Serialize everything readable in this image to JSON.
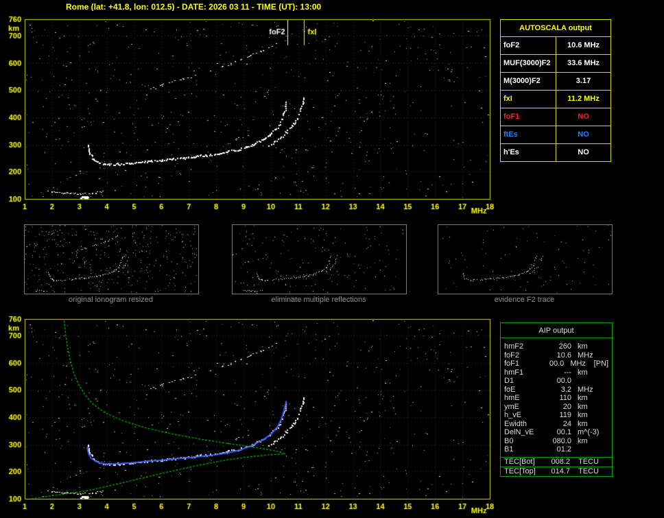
{
  "title": "Rome (lat: +41.8, lon: 012.5) - DATE: 2026 03 11 - TIME (UT): 13:00",
  "colors": {
    "background": "#000000",
    "axis_yellow": "#d6d600",
    "label_yellow": "#ffff00",
    "table_border_yellow": "#d6d600",
    "aip_border_green": "#00a000",
    "profile_green": "#00c000",
    "restored_blue": "#3a5bff",
    "red": "#ff2020",
    "blue": "#2080ff",
    "white": "#ffffff",
    "caption_gray": "#8f8f8f"
  },
  "autoscala_table": {
    "title": "AUTOSCALA output",
    "rows": [
      {
        "label": "foF2",
        "value": "10.6 MHz",
        "label_color": "#ffffff",
        "value_color": "#ffffff"
      },
      {
        "label": "MUF(3000)F2",
        "value": "33.6 MHz",
        "label_color": "#ffffff",
        "value_color": "#ffffff"
      },
      {
        "label": "M(3000)F2",
        "value": "3.17",
        "label_color": "#ffffff",
        "value_color": "#ffffff"
      },
      {
        "label": "fxI",
        "value": "11.2 MHz",
        "label_color": "#ffff00",
        "value_color": "#ffff00"
      },
      {
        "label": "foF1",
        "value": "NO",
        "label_color": "#ff2020",
        "value_color": "#ff2020"
      },
      {
        "label": "ftEs",
        "value": "NO",
        "label_color": "#2080ff",
        "value_color": "#2080ff"
      },
      {
        "label": "h'Es",
        "value": "NO",
        "label_color": "#ffffff",
        "value_color": "#ffffff"
      }
    ]
  },
  "thumbnails": [
    {
      "caption": "original ionogram resized",
      "traces": [
        "E",
        "blob",
        "F_o",
        "F_x",
        "hop2"
      ],
      "noise": 380
    },
    {
      "caption": "eliminate multiple reflections",
      "traces": [
        "E",
        "blob",
        "F_o",
        "F_x"
      ],
      "noise": 170
    },
    {
      "caption": "evidence F2 trace",
      "traces": [
        "F_o",
        "F_x"
      ],
      "noise": 90
    }
  ],
  "aip_table": {
    "title": "AIP output",
    "rows": [
      {
        "label": "hmF2",
        "value": "260",
        "unit": "km",
        "extra": ""
      },
      {
        "label": "foF2",
        "value": "10.6",
        "unit": "MHz",
        "extra": ""
      },
      {
        "label": "foF1",
        "value": "00.0",
        "unit": "MHz",
        "extra": "[PN]"
      },
      {
        "label": "hmF1",
        "value": "---",
        "unit": "km",
        "extra": ""
      },
      {
        "label": "D1",
        "value": "00.0",
        "unit": "",
        "extra": ""
      },
      {
        "label": "foE",
        "value": "3.2",
        "unit": "MHz",
        "extra": ""
      },
      {
        "label": "hmE",
        "value": "110",
        "unit": "km",
        "extra": ""
      },
      {
        "label": "ymE",
        "value": "20",
        "unit": "km",
        "extra": ""
      },
      {
        "label": "h_vE",
        "value": "119",
        "unit": "km",
        "extra": ""
      },
      {
        "label": "Ewidth",
        "value": "24",
        "unit": "km",
        "extra": ""
      },
      {
        "label": "DelN_vE",
        "value": "00.1",
        "unit": "m^(-3)",
        "extra": ""
      },
      {
        "label": "B0",
        "value": "080.0",
        "unit": "km",
        "extra": ""
      },
      {
        "label": "B1",
        "value": "01.2",
        "unit": "",
        "extra": ""
      }
    ],
    "tec_rows": [
      {
        "label": "TEC[Bot]",
        "value": "008.2",
        "unit": "TECU"
      },
      {
        "label": "TEC[Top]",
        "value": "014.7",
        "unit": "TECU"
      }
    ]
  },
  "chart_data": [
    {
      "type": "scatter",
      "name": "ionogram-top",
      "title": "ionogram with autoscaled characteristics",
      "xlabel": "MHz",
      "ylabel": "km",
      "xlim": [
        1,
        18
      ],
      "ylim": [
        100,
        760
      ],
      "x_ticks": [
        1,
        2,
        3,
        4,
        5,
        6,
        7,
        8,
        9,
        10,
        11,
        12,
        13,
        14,
        15,
        16,
        17,
        18
      ],
      "y_ticks": [
        100,
        200,
        300,
        400,
        500,
        600,
        700,
        760
      ],
      "grid": "dotted",
      "noise_count": 620,
      "markers": [
        {
          "label": "foF2",
          "freq": 10.6,
          "color": "#ffffff",
          "side": "left"
        },
        {
          "label": "fxI",
          "freq": 11.2,
          "color": "#ffff00",
          "side": "right"
        }
      ],
      "traces": [
        {
          "name": "E",
          "points": [
            [
              1.85,
              130
            ],
            [
              2.1,
              126
            ],
            [
              2.4,
              123
            ],
            [
              2.7,
              121
            ],
            [
              3.0,
              120
            ],
            [
              3.3,
              121
            ],
            [
              3.6,
              124
            ],
            [
              3.85,
              128
            ]
          ]
        },
        {
          "name": "blob",
          "points": [
            [
              3.05,
              108
            ],
            [
              3.3,
              108
            ]
          ]
        },
        {
          "name": "F_o",
          "points": [
            [
              3.3,
              298
            ],
            [
              3.38,
              268
            ],
            [
              3.5,
              248
            ],
            [
              3.65,
              238
            ],
            [
              3.85,
              231
            ],
            [
              4.1,
              228
            ],
            [
              4.4,
              229
            ],
            [
              4.8,
              232
            ],
            [
              5.2,
              236
            ],
            [
              5.6,
              240
            ],
            [
              6.0,
              244
            ],
            [
              6.4,
              248
            ],
            [
              6.8,
              252
            ],
            [
              7.2,
              256
            ],
            [
              7.6,
              261
            ],
            [
              8.0,
              267
            ],
            [
              8.4,
              274
            ],
            [
              8.8,
              283
            ],
            [
              9.1,
              293
            ],
            [
              9.4,
              305
            ],
            [
              9.7,
              320
            ],
            [
              9.95,
              337
            ],
            [
              10.15,
              355
            ],
            [
              10.3,
              375
            ],
            [
              10.4,
              398
            ],
            [
              10.48,
              424
            ],
            [
              10.54,
              450
            ],
            [
              10.57,
              466
            ]
          ]
        },
        {
          "name": "F_x",
          "points": [
            [
              9.9,
              296
            ],
            [
              10.2,
              315
            ],
            [
              10.5,
              340
            ],
            [
              10.75,
              368
            ],
            [
              10.95,
              398
            ],
            [
              11.08,
              428
            ],
            [
              11.15,
              452
            ],
            [
              11.19,
              472
            ]
          ]
        },
        {
          "name": "hop2",
          "points": [
            [
              5.6,
              505
            ],
            [
              6.0,
              518
            ],
            [
              6.4,
              530
            ],
            [
              6.8,
              542
            ],
            [
              7.2,
              554
            ],
            [
              7.6,
              567
            ],
            [
              8.0,
              580
            ],
            [
              8.4,
              594
            ],
            [
              8.8,
              610
            ],
            [
              9.2,
              626
            ],
            [
              9.6,
              644
            ],
            [
              9.9,
              658
            ],
            [
              10.15,
              670
            ]
          ]
        }
      ]
    },
    {
      "type": "scatter",
      "name": "ionogram-bottom",
      "title": "ionogram with restored trace and electron density profile",
      "xlabel": "MHz",
      "ylabel": "km",
      "xlim": [
        1,
        18
      ],
      "ylim": [
        100,
        760
      ],
      "x_ticks": [
        1,
        2,
        3,
        4,
        5,
        6,
        7,
        8,
        9,
        10,
        11,
        12,
        13,
        14,
        15,
        16,
        17,
        18
      ],
      "y_ticks": [
        100,
        200,
        300,
        400,
        500,
        600,
        700,
        760
      ],
      "grid": "dotted",
      "noise_count": 620,
      "traces_from": "ionogram-top",
      "restored": {
        "name": "restored-F2-trace",
        "color": "#3a5bff",
        "points": [
          [
            3.28,
            290
          ],
          [
            3.33,
            268
          ],
          [
            3.42,
            250
          ],
          [
            3.58,
            238
          ],
          [
            3.8,
            230
          ],
          [
            4.1,
            227
          ],
          [
            4.5,
            229
          ],
          [
            5.0,
            233
          ],
          [
            5.5,
            238
          ],
          [
            6.0,
            242
          ],
          [
            6.5,
            247
          ],
          [
            7.0,
            251
          ],
          [
            7.5,
            256
          ],
          [
            8.0,
            262
          ],
          [
            8.5,
            270
          ],
          [
            8.9,
            280
          ],
          [
            9.2,
            291
          ],
          [
            9.5,
            305
          ],
          [
            9.8,
            322
          ],
          [
            10.05,
            342
          ],
          [
            10.25,
            366
          ],
          [
            10.38,
            392
          ],
          [
            10.47,
            420
          ],
          [
            10.53,
            446
          ],
          [
            10.56,
            460
          ]
        ]
      },
      "profile": {
        "name": "electron-density-profile",
        "color": "#00c000",
        "points": [
          [
            1.25,
            100
          ],
          [
            1.7,
            107
          ],
          [
            2.2,
            114
          ],
          [
            2.8,
            122
          ],
          [
            3.2,
            128
          ],
          [
            3.8,
            141
          ],
          [
            4.5,
            157
          ],
          [
            5.2,
            174
          ],
          [
            6.0,
            193
          ],
          [
            6.8,
            211
          ],
          [
            7.6,
            228
          ],
          [
            8.4,
            243
          ],
          [
            9.2,
            254
          ],
          [
            9.8,
            260
          ],
          [
            10.3,
            264
          ],
          [
            10.5,
            265
          ],
          [
            10.35,
            272
          ],
          [
            9.9,
            281
          ],
          [
            9.2,
            292
          ],
          [
            8.3,
            305
          ],
          [
            7.3,
            321
          ],
          [
            6.3,
            340
          ],
          [
            5.4,
            361
          ],
          [
            4.6,
            386
          ],
          [
            3.95,
            415
          ],
          [
            3.5,
            447
          ],
          [
            3.2,
            482
          ],
          [
            2.97,
            520
          ],
          [
            2.8,
            560
          ],
          [
            2.68,
            603
          ],
          [
            2.58,
            650
          ],
          [
            2.5,
            700
          ],
          [
            2.44,
            760
          ]
        ]
      }
    }
  ]
}
